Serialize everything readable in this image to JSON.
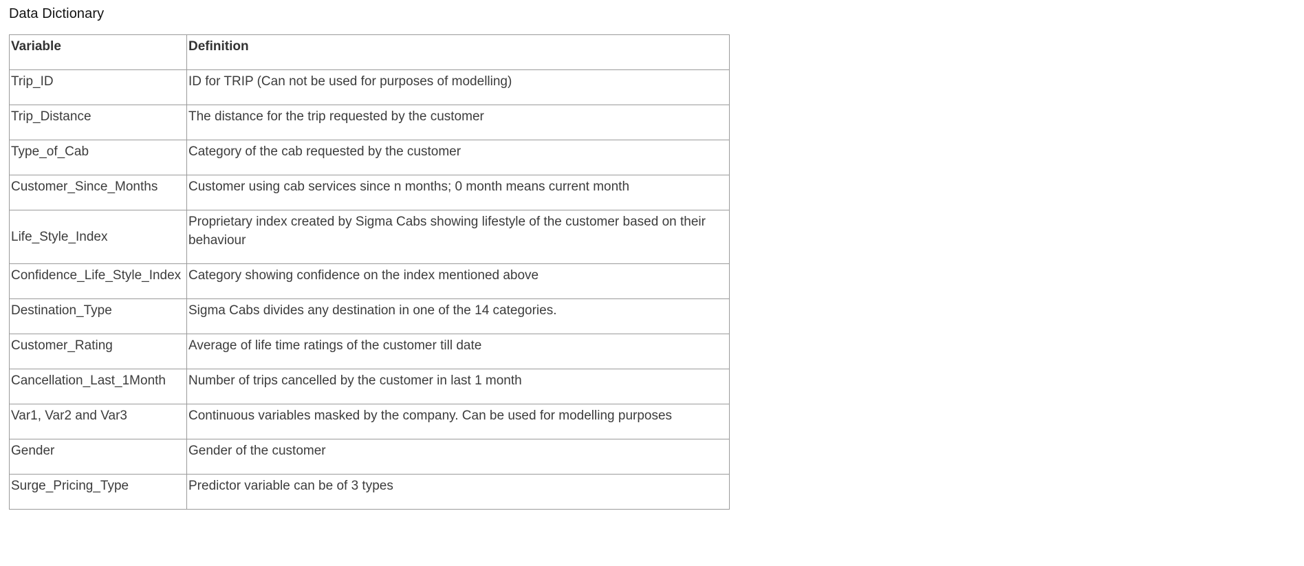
{
  "title": "Data Dictionary",
  "table": {
    "headers": [
      "Variable",
      "Definition"
    ],
    "rows": [
      {
        "variable": "Trip_ID",
        "definition": "ID for TRIP (Can not be used for purposes of modelling)"
      },
      {
        "variable": "Trip_Distance",
        "definition": "The distance for the trip requested by the customer"
      },
      {
        "variable": "Type_of_Cab",
        "definition": "Category of the cab requested by the customer"
      },
      {
        "variable": "Customer_Since_Months",
        "definition": "Customer using cab services since n months; 0 month means current month"
      },
      {
        "variable": "Life_Style_Index",
        "definition": "Proprietary index created by Sigma Cabs showing lifestyle of the customer based on their behaviour"
      },
      {
        "variable": "Confidence_Life_Style_Index",
        "definition": "Category showing confidence on the index mentioned above"
      },
      {
        "variable": "Destination_Type",
        "definition": "Sigma Cabs divides any destination in one of the 14 categories."
      },
      {
        "variable": "Customer_Rating",
        "definition": "Average of life time ratings of the customer till date"
      },
      {
        "variable": "Cancellation_Last_1Month",
        "definition": "Number of trips cancelled by the customer in last 1 month"
      },
      {
        "variable": "Var1, Var2 and Var3",
        "definition": "Continuous variables masked by the company. Can be used for modelling purposes"
      },
      {
        "variable": "Gender",
        "definition": "Gender of the customer"
      },
      {
        "variable": "Surge_Pricing_Type",
        "definition": "Predictor variable can be of 3 types"
      }
    ]
  }
}
